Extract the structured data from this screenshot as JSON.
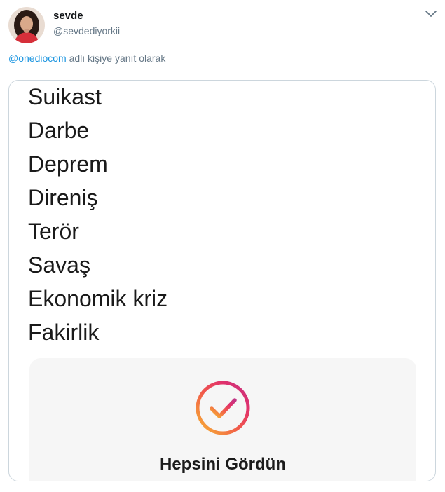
{
  "tweet": {
    "display_name": "sevde",
    "handle": "@sevdediyorkii",
    "reply_mention": "@onediocom",
    "reply_text": " adlı kişiye yanıt olarak",
    "menu_icon": "chevron-down-icon"
  },
  "image": {
    "words": [
      "Suikast",
      "Darbe",
      "Deprem",
      "Direniş",
      "Terör",
      "Savaş",
      "Ekonomik kriz",
      "Fakirlik"
    ],
    "card": {
      "label": "Hepsini Gördün",
      "icon": "check-circle-icon",
      "gradient_colors": [
        "#f7b733",
        "#e1306c",
        "#c13584"
      ]
    }
  },
  "colors": {
    "name": "#14171a",
    "secondary": "#657786",
    "link": "#1b95e0",
    "border": "#ccd6dd"
  }
}
